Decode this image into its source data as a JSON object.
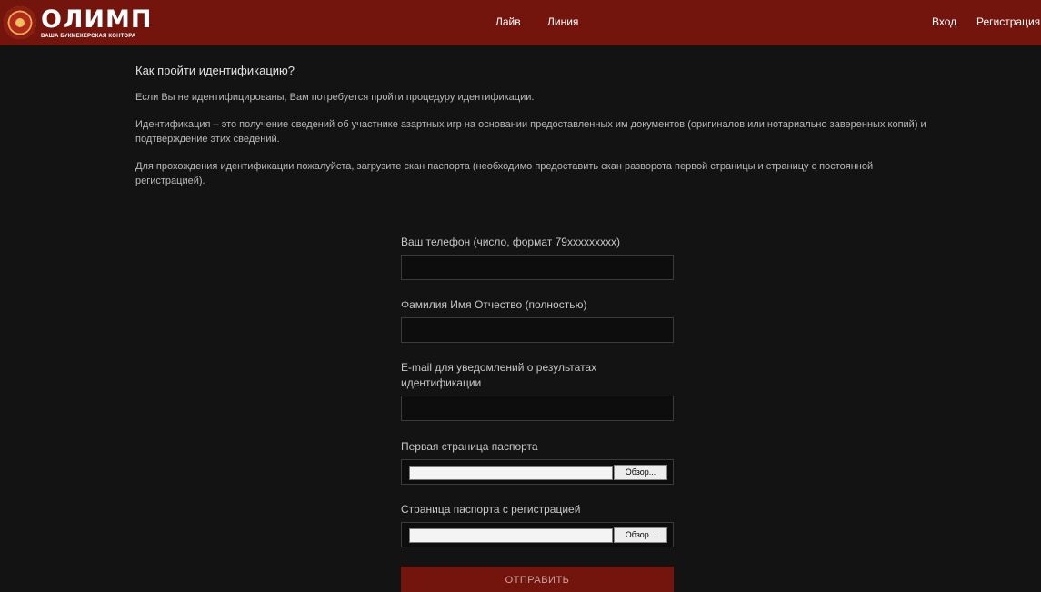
{
  "header": {
    "logo_name": "ОЛИМП",
    "logo_sub": "ВАША БУКМЕКЕРСКАЯ КОНТОРА",
    "nav": {
      "live": "Лайв",
      "line": "Линия"
    },
    "auth": {
      "login": "Вход",
      "register": "Регистрация"
    },
    "colors": {
      "bar": "#74150d",
      "background": "#131313"
    }
  },
  "info": {
    "title": "Как пройти идентификацию?",
    "paragraphs": [
      "Если Вы не идентифицированы, Вам потребуется пройти процедуру идентификации.",
      "Идентификация – это получение сведений об участнике азартных игр на основании предоставленных им документов (оригиналов или нотариально заверенных копий) и подтверждение этих сведений.",
      "Для прохождения идентификации пожалуйста, загрузите скан паспорта (необходимо предоставить скан разворота первой страницы и страницу с постоянной регистрацией)."
    ]
  },
  "form": {
    "phone_label": "Ваш телефон (число, формат 79xxxxxxxxx)",
    "phone_value": "",
    "name_label": "Фамилия Имя Отчество (полностью)",
    "name_value": "",
    "email_label": "E-mail для уведомлений о результатах идентификации",
    "email_value": "",
    "passport_first_label": "Первая страница паспорта",
    "passport_reg_label": "Страница паспорта с регистрацией",
    "browse_label": "Обзор...",
    "submit_label": "ОТПРАВИТЬ"
  }
}
